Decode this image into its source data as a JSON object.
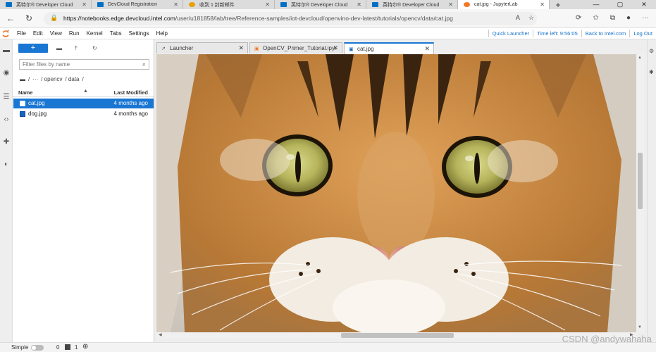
{
  "browser": {
    "tabs": [
      {
        "label": "英特尔® Developer Cloud",
        "favicon_color": "#0071c5",
        "active": false
      },
      {
        "label": "DevCloud Registration",
        "favicon_color": "#0071c5",
        "active": false
      },
      {
        "label": "收到 1 封新邮件",
        "favicon_color": "#e8a000",
        "active": false
      },
      {
        "label": "英特尔® Developer Cloud",
        "favicon_color": "#0071c5",
        "active": false
      },
      {
        "label": "英特尔® Developer Cloud",
        "favicon_color": "#0071c5",
        "active": false
      },
      {
        "label": "cat.jpg - JupyterLab",
        "favicon_color": "#f37726",
        "active": true
      }
    ],
    "new_tab": "+",
    "url_host": "https://notebooks.edge.devcloud.intel.com",
    "url_path": "/user/u181858/lab/tree/Reference-samples/iot-devcloud/openvino-dev-latest/tutorials/opencv/data/cat.jpg"
  },
  "jupyter": {
    "menus": [
      "File",
      "Edit",
      "View",
      "Run",
      "Kernel",
      "Tabs",
      "Settings",
      "Help"
    ],
    "right_links": [
      "Quick Launcher",
      "Time left: 9:56:05",
      "Back to Intel.com",
      "Log Out"
    ],
    "accent": "#1976d2"
  },
  "filebrowser": {
    "new_label": "+",
    "filter_placeholder": "Filter files by name",
    "breadcrumbs": [
      "/",
      "···",
      "/ opencv",
      "/ data",
      "/"
    ],
    "col_name": "Name",
    "col_modified": "Last Modified",
    "files": [
      {
        "name": "cat.jpg",
        "modified": "4 months ago",
        "selected": true
      },
      {
        "name": "dog.jpg",
        "modified": "4 months ago",
        "selected": false
      }
    ]
  },
  "doc_tabs": [
    {
      "label": "Launcher",
      "active": false
    },
    {
      "label": "OpenCV_Primer_Tutorial.ipyr",
      "active": false
    },
    {
      "label": "cat.jpg",
      "active": true
    }
  ],
  "statusbar": {
    "mode_label": "Simple",
    "count_a": "0",
    "count_b": "1"
  },
  "watermark": "CSDN @andywahaha"
}
